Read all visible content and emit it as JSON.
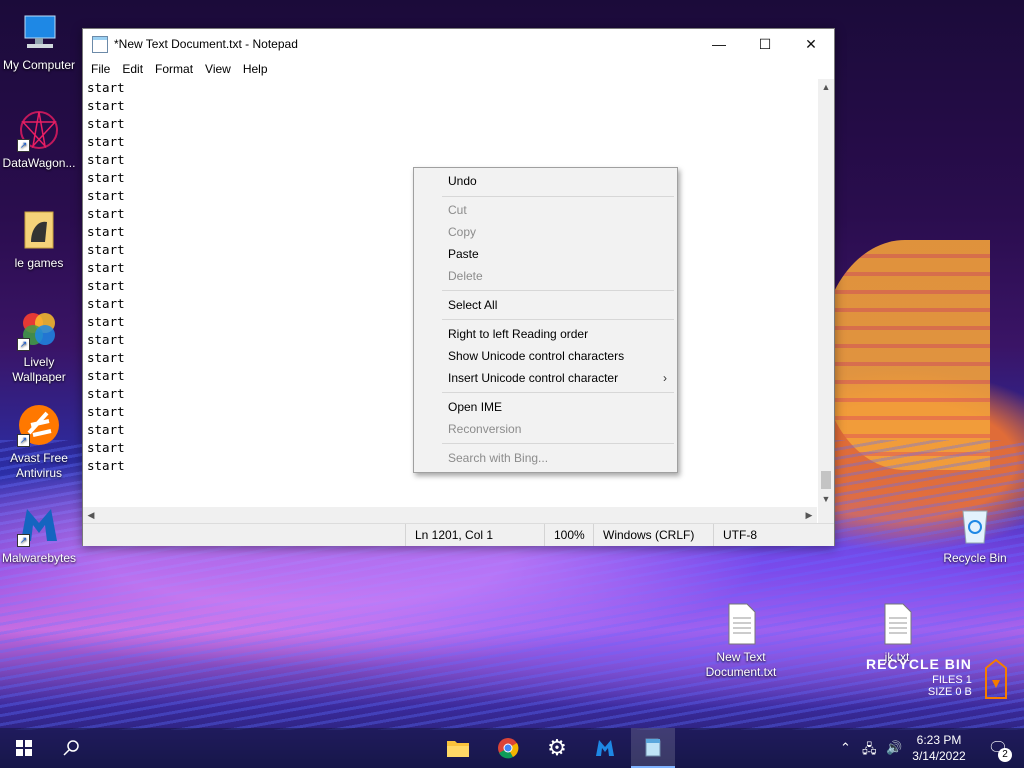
{
  "desktop": {
    "icons": [
      {
        "label": "My Computer",
        "icon": "computer-icon"
      },
      {
        "label": "DataWagon...",
        "icon": "datawagon-icon"
      },
      {
        "label": "le games",
        "icon": "folder-icon"
      },
      {
        "label": "Lively Wallpaper",
        "icon": "lively-wallpaper-icon"
      },
      {
        "label": "Avast Free Antivirus",
        "icon": "avast-icon"
      },
      {
        "label": "Malwarebytes",
        "icon": "malwarebytes-icon"
      },
      {
        "label": "Recycle Bin",
        "icon": "recycle-bin-icon"
      },
      {
        "label": "New Text Document.txt",
        "icon": "text-file-icon"
      },
      {
        "label": "jk.txt",
        "icon": "text-file-icon"
      }
    ],
    "recycle_widget": {
      "title": "RECYCLE BIN",
      "files": "FILES 1",
      "size": "SIZE 0 B"
    }
  },
  "notepad": {
    "title": "*New Text Document.txt - Notepad",
    "menu": [
      "File",
      "Edit",
      "Format",
      "View",
      "Help"
    ],
    "lines": [
      "start",
      "start",
      "start",
      "start",
      "start",
      "start",
      "start",
      "start",
      "start",
      "start",
      "start",
      "start",
      "start",
      "start",
      "start",
      "start",
      "start",
      "start",
      "start",
      "start",
      "start",
      "start"
    ],
    "status": {
      "position": "Ln 1201, Col 1",
      "zoom": "100%",
      "line_ending": "Windows (CRLF)",
      "encoding": "UTF-8"
    }
  },
  "context_menu": {
    "undo": "Undo",
    "cut": "Cut",
    "copy": "Copy",
    "paste": "Paste",
    "delete": "Delete",
    "select_all": "Select All",
    "rtl": "Right to left Reading order",
    "show_unicode": "Show Unicode control characters",
    "insert_unicode": "Insert Unicode control character",
    "open_ime": "Open IME",
    "reconversion": "Reconversion",
    "search_bing": "Search with Bing..."
  },
  "taskbar": {
    "time": "6:23 PM",
    "date": "3/14/2022",
    "notification_count": "2",
    "pinned": [
      "file-explorer-icon",
      "chrome-icon",
      "settings-icon",
      "malwarebytes-icon",
      "notepad-icon"
    ]
  }
}
